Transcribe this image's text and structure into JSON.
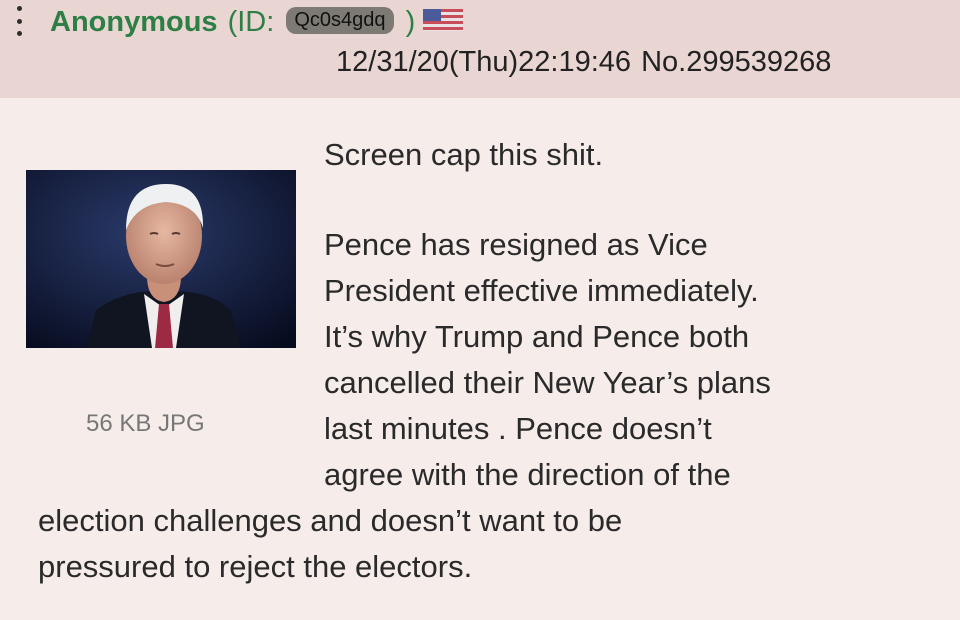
{
  "post": {
    "name": "Anonymous",
    "id_prefix": "(ID:",
    "id_value": "Qc0s4gdq",
    "id_suffix": ")",
    "flag_icon": "us-flag-icon",
    "date": "12/31/20(Thu)22:19:46",
    "number": "No.299539268",
    "file_info": "56 KB JPG",
    "message": {
      "lead": "Screen cap this shit.",
      "lines": [
        "Pence has resigned as Vice",
        "President effective immediately.",
        "It’s why Trump and Pence both",
        "cancelled their New Year’s plans",
        "last minutes . Pence doesn’t",
        "agree with the direction of the",
        "election challenges and doesn’t want to be",
        "pressured to reject the electors."
      ]
    }
  },
  "colors": {
    "header_bg": "#e9d6d2",
    "body_bg": "#f6ecea",
    "name": "#2d7f45"
  }
}
